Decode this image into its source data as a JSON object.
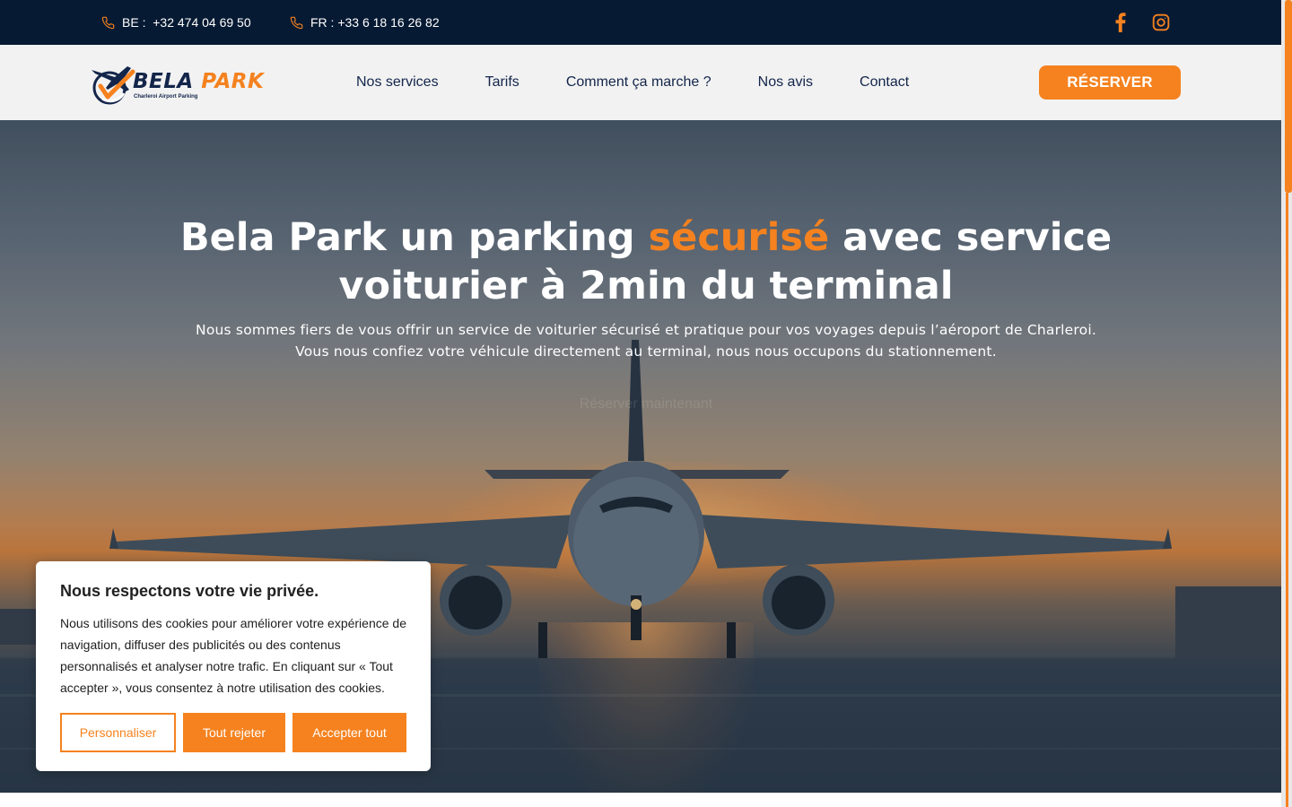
{
  "topbar": {
    "phone_be": "BE :  +32 474 04 69 50",
    "phone_fr": "FR : +33 6 18 16 26 82",
    "social": [
      "facebook-icon",
      "instagram-icon"
    ]
  },
  "nav": {
    "logo_brand_1": "BELA",
    "logo_brand_2": "PARK",
    "logo_tagline": "Charleroi Airport Parking",
    "items": [
      "Nos services",
      "Tarifs",
      "Comment ça marche ?",
      "Nos avis",
      "Contact"
    ],
    "cta": "RÉSERVER"
  },
  "hero": {
    "title_before": "Bela Park un parking ",
    "title_highlight": "sécurisé",
    "title_after": " avec service voiturier à 2min du terminal",
    "subtitle_line1": "Nous sommes fiers de vous offrir un service de voiturier sécurisé et pratique pour vos voyages depuis l’aéroport de Charleroi.",
    "subtitle_line2": "Vous nous confiez votre véhicule directement au terminal, nous nous occupons du stationnement.",
    "hidden_button": "Réserver maintenant"
  },
  "cookie": {
    "title": "Nous respectons votre vie privée.",
    "text": "Nous utilisons des cookies pour améliorer votre expérience de navigation, diffuser des publicités ou des contenus personnalisés et analyser notre trafic. En cliquant sur « Tout accepter », vous consentez à notre utilisation des cookies.",
    "customize": "Personnaliser",
    "reject": "Tout rejeter",
    "accept": "Accepter tout"
  },
  "colors": {
    "accent": "#f5821f",
    "navy": "#071a33",
    "nav_bg": "#f2f2f2"
  }
}
